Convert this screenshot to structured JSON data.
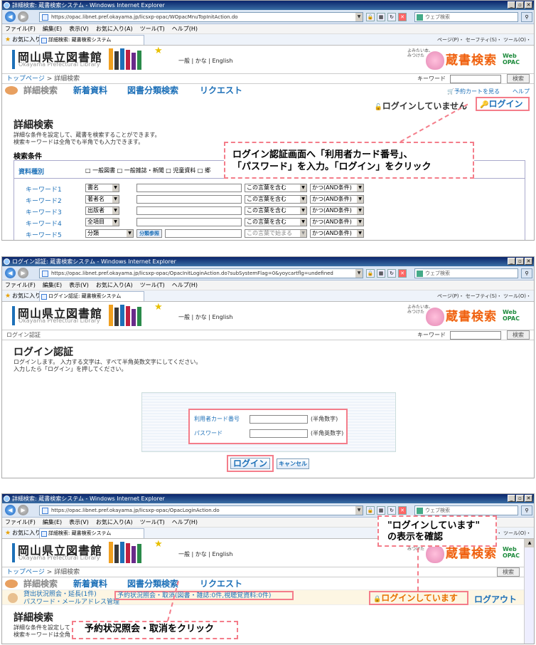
{
  "browser": {
    "s1_title": "詳細検索: 蔵書検索システム - Windows Internet Explorer",
    "s1_url": "https://opac.libnet.pref.okayama.jp/licsxp-opac/WOpacMnuTopInitAction.do",
    "s1_tab": "詳細検索: 蔵書検索システム",
    "s2_title": "ログイン認証: 蔵書検索システム - Windows Internet Explorer",
    "s2_url": "https://opac.libnet.pref.okayama.jp/licsxp-opac/OpacInitLoginAction.do?subSystemFlag=0&yoycartflg=undefined",
    "s2_tab": "ログイン認証: 蔵書検索システム",
    "s3_title": "詳細検索: 蔵書検索システム - Windows Internet Explorer",
    "s3_url": "https://opac.libnet.pref.okayama.jp/licsxp-opac/OpacLoginAction.do",
    "s3_tab": "詳細検索: 蔵書検索システム",
    "search_placeholder": "ウェブ検索",
    "menu": [
      "ファイル(F)",
      "編集(E)",
      "表示(V)",
      "お気に入り(A)",
      "ツール(T)",
      "ヘルプ(H)"
    ],
    "favorites": "お気に入り",
    "command_bar": "ページ(P)・ セーフティ(S)・ ツール(O)・"
  },
  "site": {
    "library_name": "岡山県立図書館",
    "library_sub": "Okayama Prefectural Library",
    "lang_links": "一般 | かな | English",
    "catchphrase_1": "よみたい本、",
    "catchphrase_2": "みつけた",
    "logo_text": "蔵書検索",
    "web_opac_1": "Web",
    "web_opac_2": "OPAC",
    "keyword_label": "キーワード",
    "search_button": "検索",
    "breadcrumb_top": "トップページ",
    "breadcrumb_sep": " > ",
    "breadcrumb_current": "詳細検索",
    "nav": [
      "詳細検索",
      "新着資料",
      "図書分類検索",
      "リクエスト"
    ],
    "cart_link": "予約カートを見る",
    "help_link": "ヘルプ"
  },
  "s1": {
    "not_logged_in": "ログインしていません",
    "login_link": "ログイン",
    "heading": "詳細検索",
    "desc_1": "詳細な条件を設定して、蔵書を検索することができます。",
    "desc_2": "検索キーワードは全角でも半角でも入力できます。",
    "conditions": "検索条件",
    "material_type": "資料種別",
    "checkboxes": "□ 一般図書 □ 一般雑誌・新聞 □ 児童資料 □ 郷",
    "rows": [
      {
        "label": "キーワード1",
        "field": "書名",
        "match": "この言葉を含む",
        "op": "かつ(AND条件)"
      },
      {
        "label": "キーワード2",
        "field": "著者名",
        "match": "この言葉を含む",
        "op": "かつ(AND条件)"
      },
      {
        "label": "キーワード3",
        "field": "出版者",
        "match": "この言葉を含む",
        "op": "かつ(AND条件)"
      },
      {
        "label": "キーワード4",
        "field": "全項目",
        "match": "この言葉を含む",
        "op": "かつ(AND条件)"
      },
      {
        "label": "キーワード5",
        "field": "分類",
        "match": "この言葉で始まる",
        "op": "かつ(AND条件)"
      }
    ],
    "bunrui_button": "分類参照",
    "callout_1": "ログイン認証画面へ「利用者カード番号」、",
    "callout_2": "「パスワード」を入力。「ログイン」をクリック"
  },
  "s2": {
    "breadcrumb": "ログイン認証",
    "heading": "ログイン認証",
    "desc_1": "ログインします。 入力する文字は、すべて半角英数文字にしてください。",
    "desc_2": "入力したら「ログイン」を押してください。",
    "card_label": "利用者カード番号",
    "card_hint": "(半角数字)",
    "password_label": "パスワード",
    "password_hint": "(半角英数字)",
    "login_button": "ログイン",
    "cancel_button": "キャンセル"
  },
  "s3": {
    "loan_status": "貸出状況照会・延長(1件)",
    "password_mail": "パスワード・メールアドレス管理",
    "reserve_status": "予約状況照会・取消(図書・雑誌:0件,視聴覚資料:0件)",
    "logged_in": "ログインしています",
    "logout": "ログアウト",
    "heading": "詳細検索",
    "desc_1": "詳細な条件を設定して",
    "desc_2": "検索キーワードは全角",
    "callout_top_1": "\"ログインしています\"",
    "callout_top_2": "の表示を確認",
    "callout_bottom": "予約状況照会・取消をクリック"
  },
  "colors": {
    "accent_blue": "#1d70b8",
    "callout_pink": "#f47d8a",
    "logo_orange": "#f06010"
  }
}
